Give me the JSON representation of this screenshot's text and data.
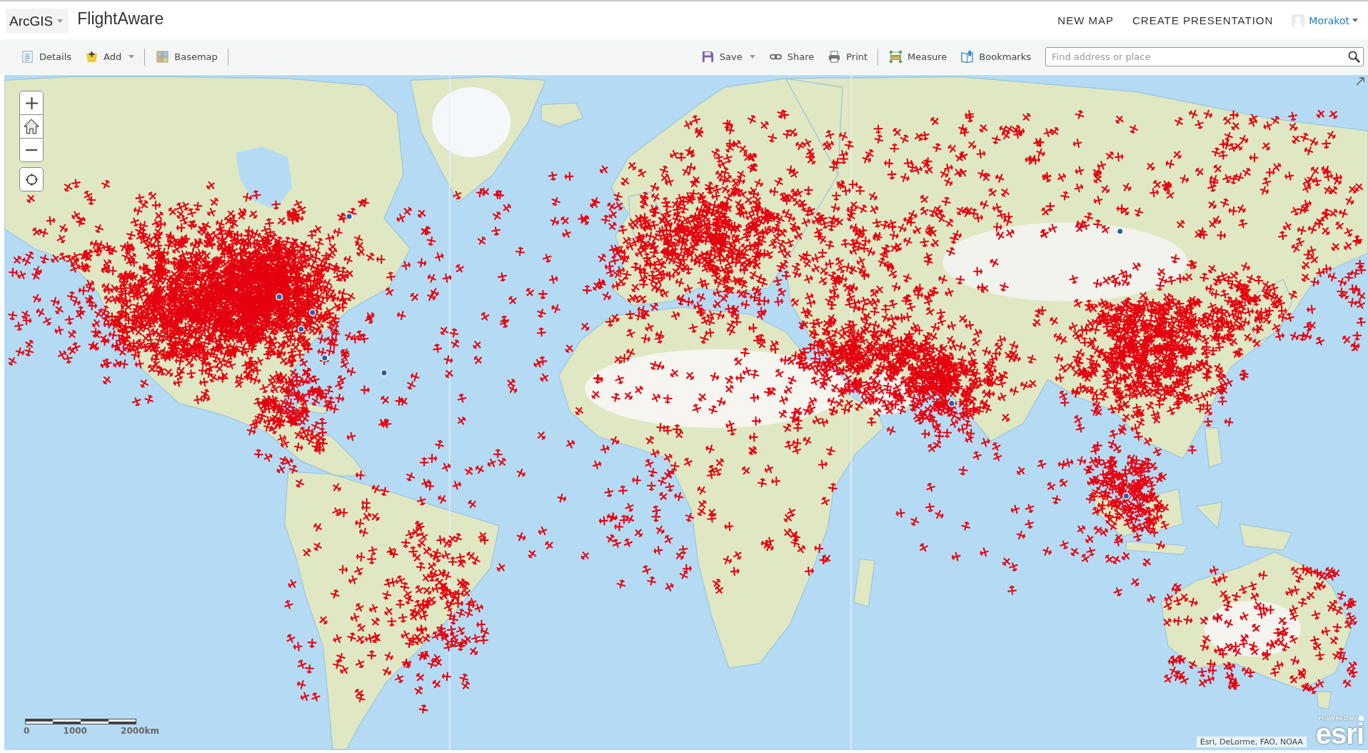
{
  "header": {
    "app_menu": {
      "label": "ArcGIS"
    },
    "title": "FlightAware",
    "links": [
      "NEW MAP",
      "CREATE PRESENTATION"
    ],
    "user": {
      "name": "Morakot"
    }
  },
  "toolbar": {
    "left": [
      {
        "kind": "details",
        "label": "Details",
        "dropdown": false,
        "divider_after": false
      },
      {
        "kind": "add",
        "label": "Add",
        "dropdown": true,
        "divider_after": true
      },
      {
        "kind": "basemap",
        "label": "Basemap",
        "dropdown": false,
        "divider_after": true
      }
    ],
    "right": [
      {
        "kind": "save",
        "label": "Save",
        "dropdown": true,
        "divider_after": false
      },
      {
        "kind": "share",
        "label": "Share",
        "dropdown": false,
        "divider_after": false
      },
      {
        "kind": "print",
        "label": "Print",
        "dropdown": false,
        "divider_after": true
      },
      {
        "kind": "measure",
        "label": "Measure",
        "dropdown": false,
        "divider_after": false
      },
      {
        "kind": "bookmarks",
        "label": "Bookmarks",
        "dropdown": false,
        "divider_after": false
      }
    ],
    "search": {
      "placeholder": "Find address or place"
    }
  },
  "map": {
    "scale_labels": [
      "0",
      "1000",
      "2000km"
    ],
    "attribution": "Esri, DeLorme, FAO, NOAA",
    "logo": {
      "caption": "POWERED BY",
      "wordmark": "esri"
    }
  }
}
